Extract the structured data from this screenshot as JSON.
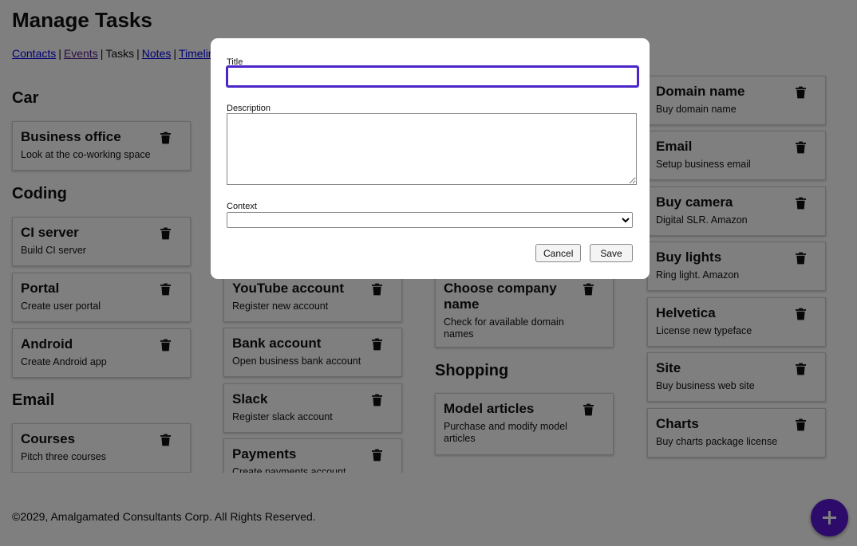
{
  "page": {
    "title": "Manage Tasks"
  },
  "nav": {
    "contacts": "Contacts",
    "events": "Events",
    "tasks": "Tasks",
    "notes": "Notes",
    "timeline": "Timeline",
    "separator": "|"
  },
  "columns": [
    {
      "groups": [
        {
          "context": "Car",
          "cards": [
            {
              "title": "Business office",
              "description": "Look at the co-working space"
            }
          ]
        },
        {
          "context": "Coding",
          "cards": [
            {
              "title": "CI server",
              "description": "Build CI server"
            },
            {
              "title": "Portal",
              "description": "Create user portal"
            },
            {
              "title": "Android",
              "description": "Create Android app"
            }
          ]
        },
        {
          "context": "Email",
          "cards": [
            {
              "title": "Courses",
              "description": "Pitch three courses"
            }
          ]
        }
      ]
    },
    {
      "groups": [
        {
          "context": "",
          "cards": [
            {
              "title": "YouTube account",
              "description": "Register new account"
            },
            {
              "title": "Bank account",
              "description": "Open business bank account"
            },
            {
              "title": "Slack",
              "description": "Register slack account"
            },
            {
              "title": "Payments",
              "description": "Create payments account"
            }
          ]
        }
      ]
    },
    {
      "groups": [
        {
          "context": "",
          "cards": [
            {
              "title": "Choose company name",
              "description": "Check for available domain names"
            }
          ]
        },
        {
          "context": "Shopping",
          "cards": [
            {
              "title": "Model articles",
              "description": "Purchase and modify model articles"
            }
          ]
        }
      ]
    },
    {
      "groups": [
        {
          "context": "",
          "cards": [
            {
              "title": "Domain name",
              "description": "Buy domain name"
            },
            {
              "title": "Email",
              "description": "Setup business email"
            },
            {
              "title": "Buy camera",
              "description": "Digital SLR. Amazon"
            },
            {
              "title": "Buy lights",
              "description": "Ring light. Amazon"
            },
            {
              "title": "Helvetica",
              "description": "License new typeface"
            },
            {
              "title": "Site",
              "description": "Buy business web site"
            },
            {
              "title": "Charts",
              "description": "Buy charts package license"
            }
          ]
        }
      ]
    }
  ],
  "footer": {
    "copyright": "©2029, Amalgamated Consultants Corp. All Rights Reserved."
  },
  "modal": {
    "title_label": "Title",
    "title_value": "",
    "description_label": "Description",
    "description_value": "",
    "context_label": "Context",
    "context_selected": "",
    "cancel_label": "Cancel",
    "save_label": "Save"
  },
  "icons": {
    "delete": "trash-icon",
    "add": "plus-icon"
  },
  "colors": {
    "accent": "#5b17d4",
    "focus": "#4a25c9",
    "link": "#0000ee",
    "visited": "#551a8b"
  }
}
